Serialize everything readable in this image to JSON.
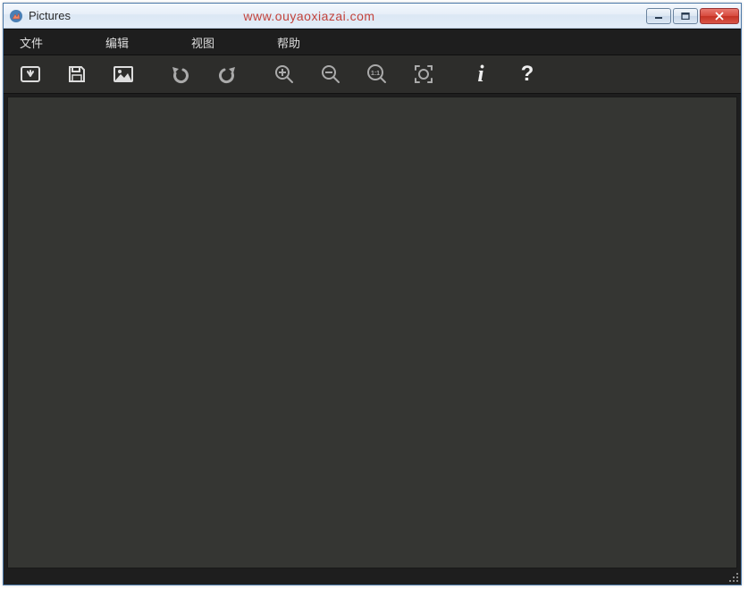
{
  "window": {
    "title": "Pictures"
  },
  "watermark": "www.ouyaoxiazai.com",
  "menubar": {
    "file": "文件",
    "edit": "编辑",
    "view": "视图",
    "help": "帮助"
  },
  "toolbar": {
    "open": "open",
    "save": "save",
    "image": "image",
    "undo": "undo",
    "redo": "redo",
    "zoom_in": "zoom-in",
    "zoom_out": "zoom-out",
    "zoom_actual": "1:1",
    "zoom_fit": "fit",
    "info": "i",
    "help": "?"
  }
}
